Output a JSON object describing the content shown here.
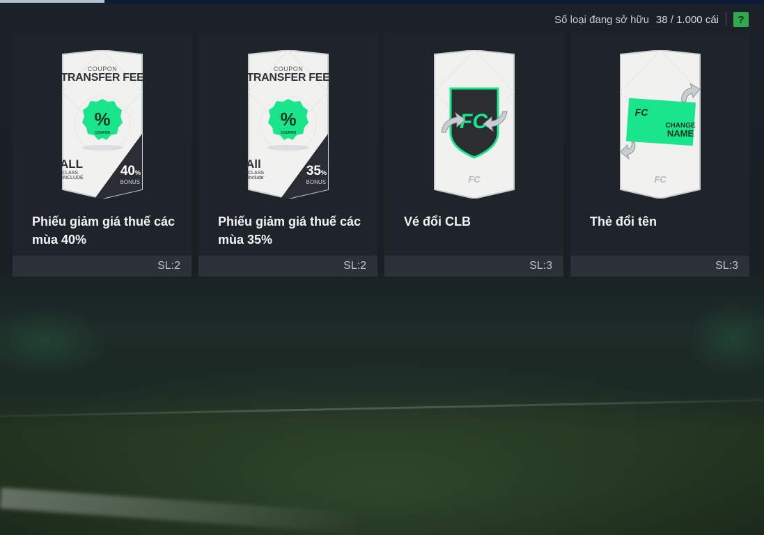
{
  "header": {
    "owned_label": "Số loại đang sở hữu",
    "owned_count": "38 / 1.000 cái",
    "help_label": "?"
  },
  "items": [
    {
      "name": "Phiếu giảm giá thuế các mùa 40%",
      "qty": "SL:2",
      "card": {
        "coupon": "COUPON",
        "title": "TRANSFER FEE",
        "badge": "%",
        "badge_sub": "COUPON",
        "all": "ALL",
        "class_line1": "CLASS",
        "class_line2": "INCLUDE",
        "pct": "40",
        "pct_unit": "%",
        "bonus": "BONUS"
      }
    },
    {
      "name": "Phiếu giảm giá thuế các mùa 35%",
      "qty": "SL:2",
      "card": {
        "coupon": "COUPON",
        "title": "TRANSFER FEE",
        "badge": "%",
        "badge_sub": "COUPON",
        "all": "All",
        "class_line1": "CLASS",
        "class_line2": "Include",
        "pct": "35",
        "pct_unit": "%",
        "bonus": "BONUS"
      }
    },
    {
      "name": "Vé đổi CLB",
      "qty": "SL:3"
    },
    {
      "name": "Thẻ đổi tên",
      "qty": "SL:3",
      "card": {
        "line1": "CHANGE",
        "line2": "NAME"
      }
    }
  ],
  "colors": {
    "accent_green": "#19e58a",
    "help_green": "#2fa84f",
    "panel": "#20252a"
  }
}
